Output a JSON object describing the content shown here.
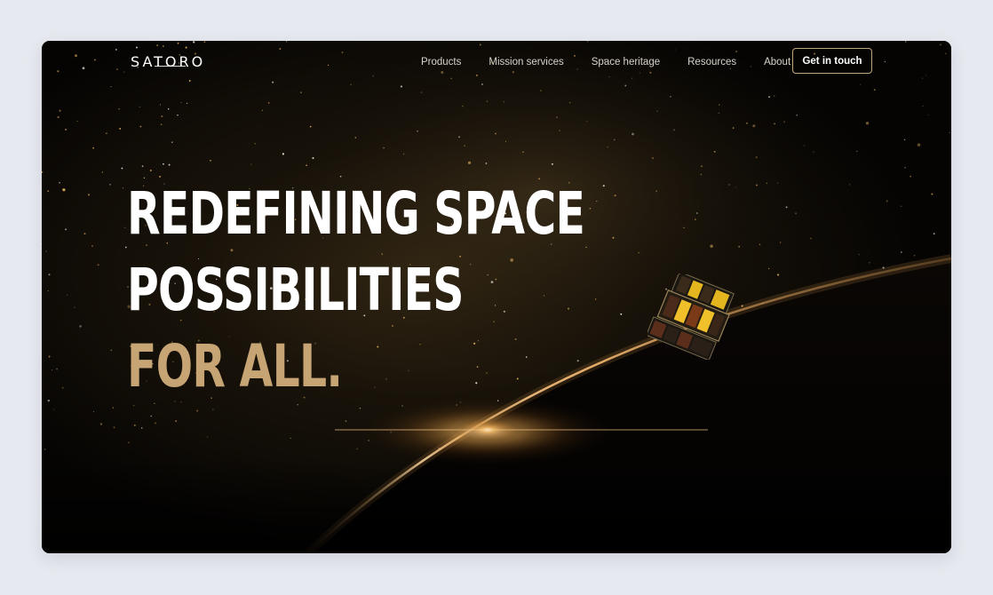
{
  "brand": {
    "logo_text": "SATORO"
  },
  "nav": {
    "items": [
      {
        "label": "Products"
      },
      {
        "label": "Mission services"
      },
      {
        "label": "Space heritage"
      },
      {
        "label": "Resources"
      },
      {
        "label": "About"
      }
    ],
    "cta_label": "Get in touch"
  },
  "hero": {
    "headline_line1": "REDEFINING SPACE",
    "headline_line2": "POSSIBILITIES",
    "headline_line3": "FOR ALL."
  },
  "colors": {
    "background": "#050403",
    "accent_gold": "#c6a474",
    "cta_border": "#c2a57b",
    "page_backdrop": "#e6e9ef"
  },
  "icons": {
    "hero_image": "satellite-icon"
  }
}
